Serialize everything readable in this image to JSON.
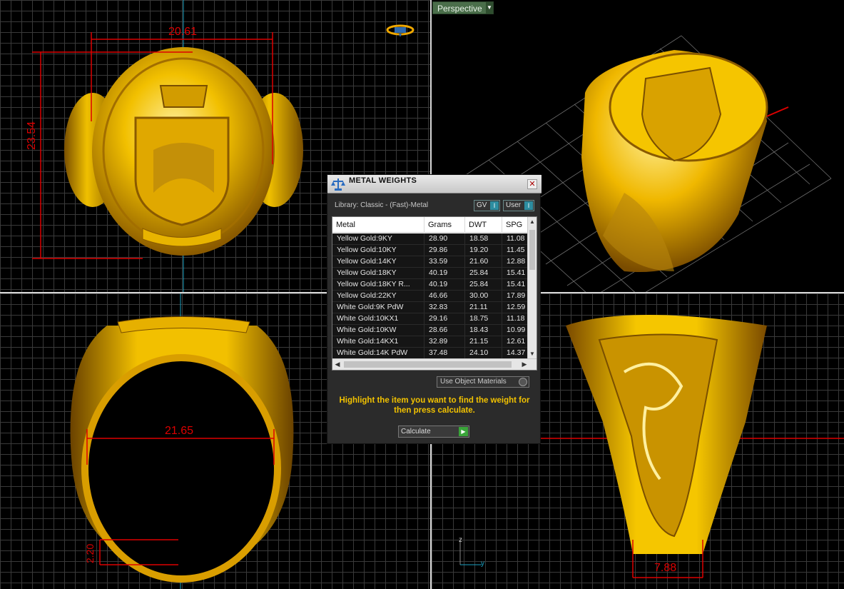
{
  "viewports": {
    "perspective_label": "Perspective"
  },
  "dimensions": {
    "top_width": "20.61",
    "top_height": "23.54",
    "inner_diameter": "21.65",
    "shank_thickness": "2.20",
    "shank_width": "7.88"
  },
  "axis": {
    "z": "z",
    "y": "y"
  },
  "dialog": {
    "title": "METAL WEIGHTS",
    "close": "✕",
    "library": "Library: Classic - (Fast)-Metal",
    "gv_label": "GV",
    "user_label": "User",
    "toggle_indicator": "I",
    "columns": [
      "Metal",
      "Grams",
      "DWT",
      "SPG"
    ],
    "rows": [
      [
        "Yellow Gold:9KY",
        "28.90",
        "18.58",
        "11.08"
      ],
      [
        "Yellow Gold:10KY",
        "29.86",
        "19.20",
        "11.45"
      ],
      [
        "Yellow Gold:14KY",
        "33.59",
        "21.60",
        "12.88"
      ],
      [
        "Yellow Gold:18KY",
        "40.19",
        "25.84",
        "15.41"
      ],
      [
        "Yellow Gold:18KY R...",
        "40.19",
        "25.84",
        "15.41"
      ],
      [
        "Yellow Gold:22KY",
        "46.66",
        "30.00",
        "17.89"
      ],
      [
        "White Gold:9K PdW",
        "32.83",
        "21.11",
        "12.59"
      ],
      [
        "White Gold:10KX1",
        "29.16",
        "18.75",
        "11.18"
      ],
      [
        "White Gold:10KW",
        "28.66",
        "18.43",
        "10.99"
      ],
      [
        "White Gold:14KX1",
        "32.89",
        "21.15",
        "12.61"
      ],
      [
        "White Gold:14K PdW",
        "37.48",
        "24.10",
        "14.37"
      ]
    ],
    "use_object_materials": "Use Object Materials",
    "hint": "Highlight the item you want to find the weight for then press calculate.",
    "calculate_label": "Calculate"
  },
  "colors": {
    "gold": "#f0b800",
    "dimension": "#dd0000",
    "hint": "#f2c200"
  }
}
